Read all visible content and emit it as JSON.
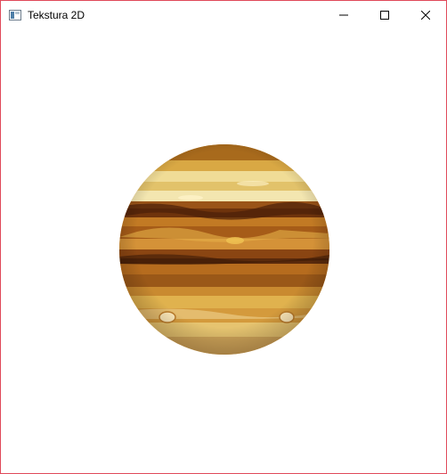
{
  "window": {
    "title": "Tekstura 2D",
    "border_color": "#e04a5a",
    "background": "#ffffff"
  },
  "controls": {
    "minimize_icon": "minimize-icon",
    "maximize_icon": "maximize-icon",
    "close_icon": "close-icon"
  },
  "canvas": {
    "content": "textured-circle",
    "texture": "jupiter-like-planet",
    "colors": [
      "#b8741f",
      "#e8c25a",
      "#7a3e10",
      "#f3e2a2",
      "#5a2a0c"
    ]
  }
}
